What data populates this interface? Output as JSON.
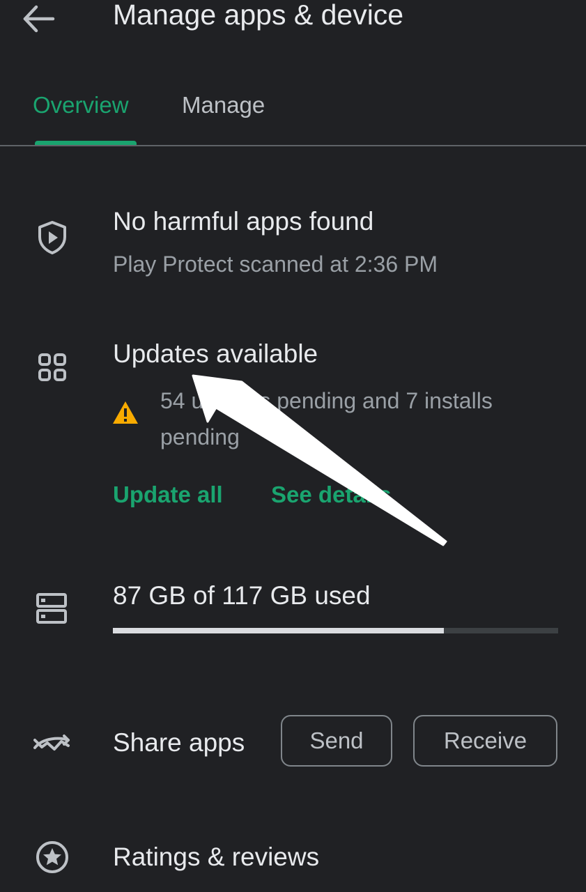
{
  "header": {
    "title": "Manage apps & device",
    "back_icon": "arrow-back-icon"
  },
  "tabs": [
    {
      "label": "Overview",
      "selected": true
    },
    {
      "label": "Manage",
      "selected": false
    }
  ],
  "colors": {
    "background": "#202124",
    "accent": "#1aa46f",
    "warning": "#f9ab00",
    "primary_text": "#e8eaed",
    "secondary_text": "#9aa0a6"
  },
  "protect": {
    "icon": "shield-play-icon",
    "title": "No harmful apps found",
    "subtitle": "Play Protect scanned at 2:36 PM"
  },
  "updates": {
    "icon": "apps-grid-icon",
    "title": "Updates available",
    "warning_icon": "warning-icon",
    "subtitle": "54 updates pending and 7 installs pending",
    "update_all_label": "Update all",
    "see_details_label": "See details"
  },
  "storage": {
    "icon": "storage-icon",
    "text": "87 GB of 117 GB used",
    "used_gb": 87,
    "total_gb": 117
  },
  "share": {
    "icon": "share-apps-icon",
    "label": "Share apps",
    "send_label": "Send",
    "receive_label": "Receive"
  },
  "ratings": {
    "icon": "star-icon",
    "label": "Ratings & reviews"
  },
  "annotation": {
    "icon": "annotation-arrow-icon"
  }
}
